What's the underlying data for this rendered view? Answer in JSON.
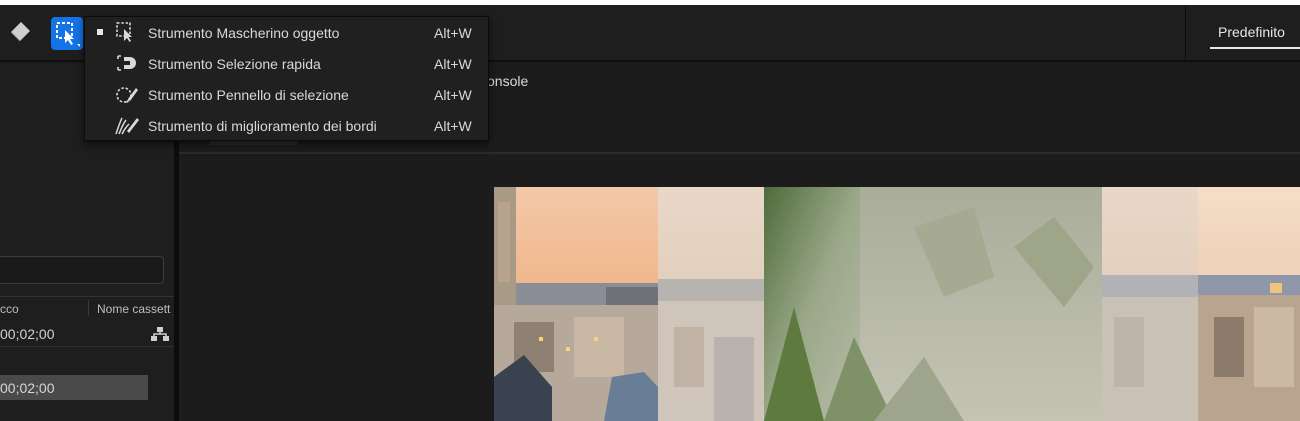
{
  "toolbar": {
    "tools": [
      {
        "icon": "eraser-icon",
        "selected": false
      },
      {
        "icon": "object-mask-tool-icon",
        "selected": true
      }
    ],
    "workspace_label": "Predefinito",
    "accent_color": "#1473e6"
  },
  "tool_menu": {
    "items": [
      {
        "label": "Strumento Mascherino oggetto",
        "shortcut": "Alt+W",
        "icon": "object-mask-tool-icon",
        "checked": true
      },
      {
        "label": "Strumento Selezione rapida",
        "shortcut": "Alt+W",
        "icon": "quick-selection-tool-icon",
        "checked": false
      },
      {
        "label": "Strumento Pennello di selezione",
        "shortcut": "Alt+W",
        "icon": "selection-brush-tool-icon",
        "checked": false
      },
      {
        "label": "Strumento di miglioramento dei bordi",
        "shortcut": "Alt+W",
        "icon": "refine-edge-tool-icon",
        "checked": false
      }
    ]
  },
  "left_panel": {
    "columns": [
      "cco",
      "Nome cassett"
    ],
    "rows": [
      {
        "timecode": "00;02;00",
        "icon": "hierarchy-icon"
      }
    ],
    "selected_timecode": "00;02;00"
  },
  "main": {
    "console_label": "onsole"
  }
}
